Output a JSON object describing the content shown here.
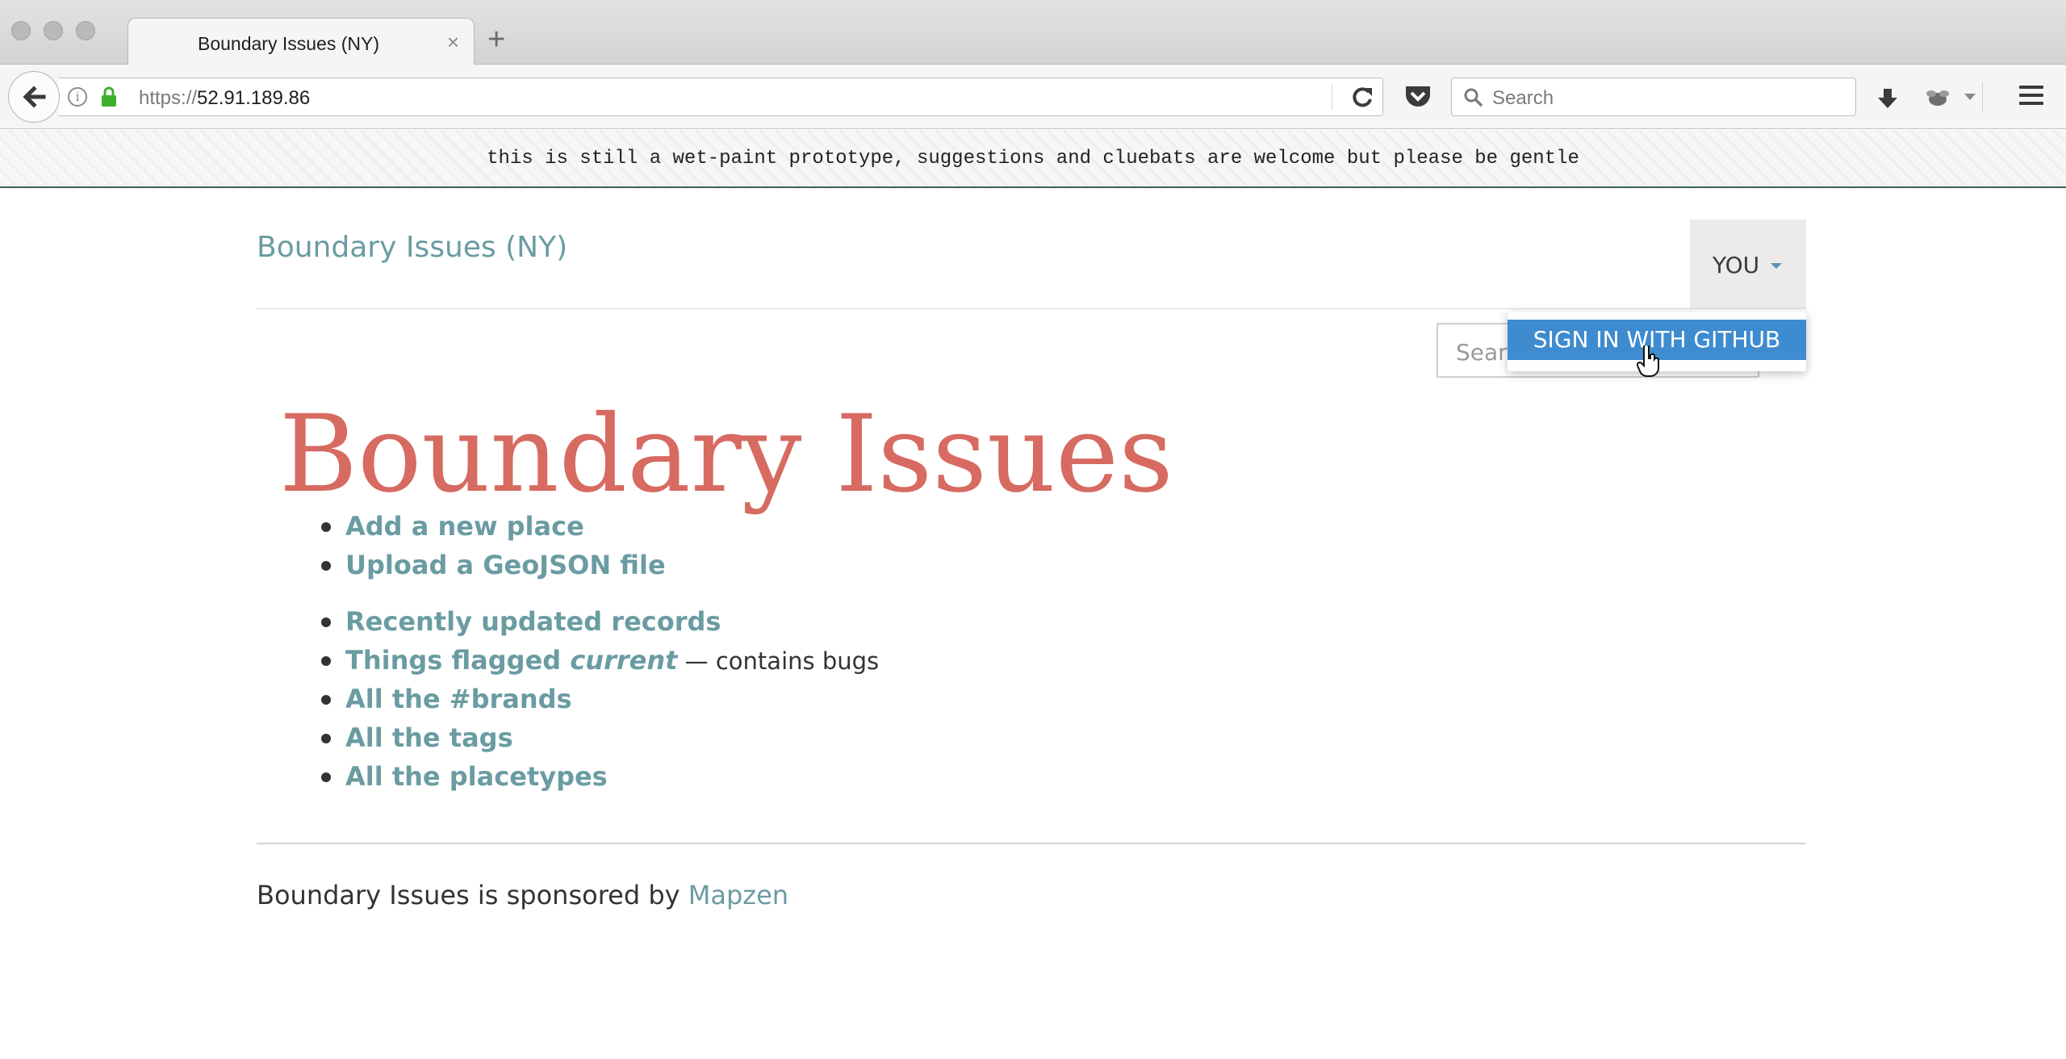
{
  "browser": {
    "tab_title": "Boundary Issues (NY)",
    "tab_close": "×",
    "new_tab": "+",
    "url_scheme": "https://",
    "url_host": "52.91.189.86",
    "search_placeholder": "Search",
    "icons": [
      "back-arrow-icon",
      "info-icon",
      "lock-icon",
      "reload-icon",
      "pocket-icon",
      "search-icon",
      "download-icon",
      "addon-icon",
      "hamburger-menu-icon"
    ]
  },
  "banner": {
    "text": "this is still a wet-paint prototype, suggestions and cluebats are welcome but please be gentle"
  },
  "header": {
    "site_title": "Boundary Issues (NY)",
    "user_menu_label": "YOU",
    "search_placeholder": "Search",
    "dropdown_item": "SIGN IN WITH GITHUB"
  },
  "main": {
    "title": "Boundary Issues",
    "list_primary": [
      "Add a new place",
      "Upload a GeoJSON file"
    ],
    "list_secondary": {
      "recent": "Recently updated records",
      "flagged_prefix": "Things flagged ",
      "flagged_emphasis": "current",
      "flagged_note": " — contains bugs",
      "brands": "All the #brands",
      "tags": "All the tags",
      "placetypes": "All the placetypes"
    }
  },
  "footer": {
    "text": "Boundary Issues is sponsored by ",
    "link": "Mapzen"
  },
  "colors": {
    "link": "#6a9ca2",
    "title": "#d76a61",
    "dropdown_active": "#3f8bcf",
    "banner_border": "#3b5e5e"
  }
}
